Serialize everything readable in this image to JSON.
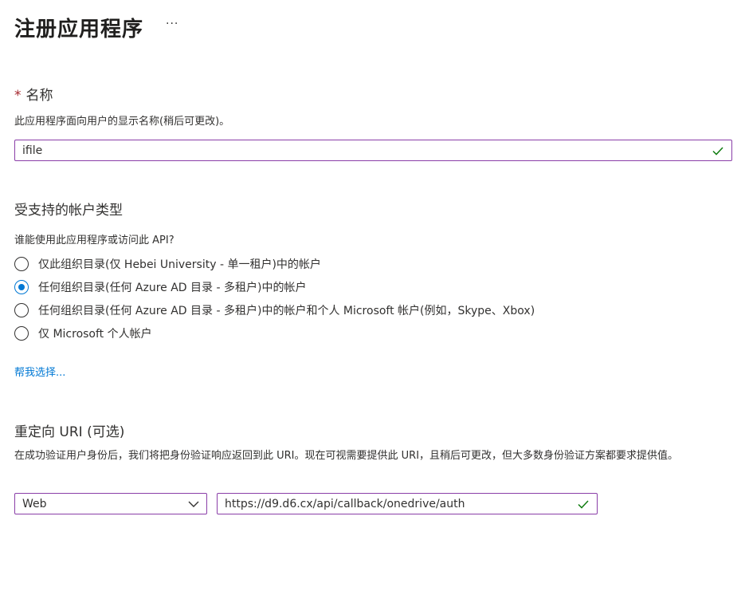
{
  "header": {
    "title": "注册应用程序",
    "more_label": "···"
  },
  "name_section": {
    "required_mark": "*",
    "label": "名称",
    "description": "此应用程序面向用户的显示名称(稍后可更改)。",
    "value": "ifile"
  },
  "accounts_section": {
    "label": "受支持的帐户类型",
    "question": "谁能使用此应用程序或访问此 API?",
    "options": [
      {
        "label": "仅此组织目录(仅 Hebei University - 单一租户)中的帐户",
        "checked": false
      },
      {
        "label": "任何组织目录(任何 Azure AD 目录 - 多租户)中的帐户",
        "checked": true
      },
      {
        "label": "任何组织目录(任何 Azure AD 目录 - 多租户)中的帐户和个人 Microsoft 帐户(例如，Skype、Xbox)",
        "checked": false
      },
      {
        "label": "仅 Microsoft 个人帐户",
        "checked": false
      }
    ],
    "help_link": "帮我选择..."
  },
  "redirect_section": {
    "label": "重定向 URI (可选)",
    "description": "在成功验证用户身份后，我们将把身份验证响应返回到此 URI。现在可视需要提供此 URI，且稍后可更改，但大多数身份验证方案都要求提供值。",
    "platform_value": "Web",
    "uri_value": "https://d9.d6.cx/api/callback/onedrive/auth"
  },
  "colors": {
    "accent": "#0078d4",
    "focus_border": "#8a3ea8",
    "valid_check": "#107c10",
    "required": "#a4262c"
  }
}
